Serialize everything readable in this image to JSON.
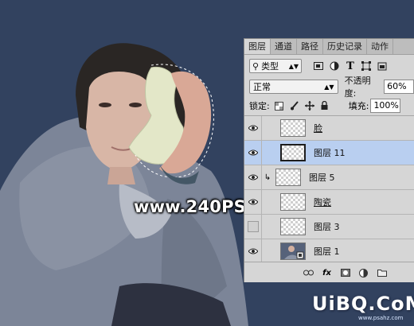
{
  "watermark": "www.240PS.com",
  "site_logo": "UiBQ.CoM",
  "site_url": "www.psahz.com",
  "panel": {
    "tabs": [
      "图层",
      "通道",
      "路径",
      "历史记录",
      "动作"
    ],
    "active_tab": "图层",
    "filter_kind": "类型",
    "blend_mode": "正常",
    "opacity_label": "不透明度:",
    "opacity_value": "60%",
    "lock_label": "锁定:",
    "fill_label": "填充:",
    "fill_value": "100%",
    "layers": [
      {
        "name": "脸",
        "visible": true,
        "selected": false,
        "clipped": false
      },
      {
        "name": "图层 11",
        "visible": true,
        "selected": true,
        "clipped": false
      },
      {
        "name": "图层 5",
        "visible": true,
        "selected": false,
        "clipped": true
      },
      {
        "name": "陶瓷",
        "visible": true,
        "selected": false,
        "clipped": false
      },
      {
        "name": "图层 3",
        "visible": false,
        "selected": false,
        "clipped": false
      },
      {
        "name": "图层 1",
        "visible": true,
        "selected": false,
        "clipped": false
      }
    ]
  },
  "colors": {
    "background": "#32425f",
    "panel": "#d6d6d6",
    "selected_layer": "#b9cff0",
    "coat": "#7a8396"
  }
}
